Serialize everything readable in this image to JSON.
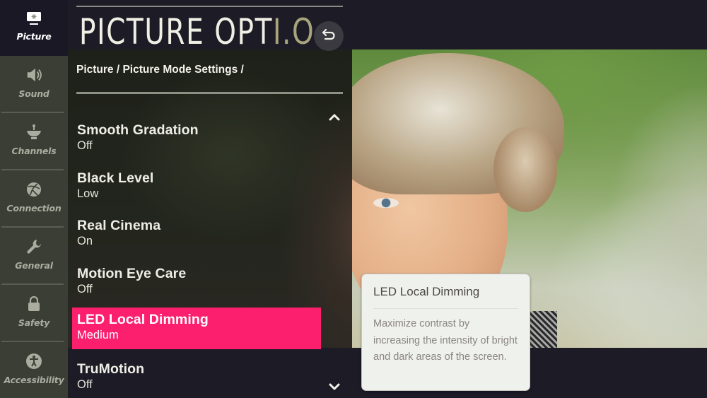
{
  "sidebar": {
    "items": [
      {
        "label": "Picture",
        "icon": "tv-picture-icon",
        "active": true
      },
      {
        "label": "Sound",
        "icon": "speaker-icon",
        "active": false
      },
      {
        "label": "Channels",
        "icon": "satellite-dish-icon",
        "active": false
      },
      {
        "label": "Connection",
        "icon": "globe-connection-icon",
        "active": false
      },
      {
        "label": "General",
        "icon": "wrench-icon",
        "active": false
      },
      {
        "label": "Safety",
        "icon": "lock-icon",
        "active": false
      },
      {
        "label": "Accessibility",
        "icon": "accessibility-person-icon",
        "active": false
      }
    ]
  },
  "header": {
    "title_main": "PICTURE OPT",
    "title_fading": "I.O",
    "back_icon": "back-arrow-icon",
    "breadcrumb": "Picture / Picture Mode Settings /"
  },
  "menu": {
    "scroll_up_icon": "chevron-up-icon",
    "scroll_down_icon": "chevron-down-icon",
    "items": [
      {
        "name": "Smooth Gradation",
        "value": "Off",
        "selected": false
      },
      {
        "name": "Black Level",
        "value": "Low",
        "selected": false
      },
      {
        "name": "Real Cinema",
        "value": "On",
        "selected": false
      },
      {
        "name": "Motion Eye Care",
        "value": "Off",
        "selected": false
      },
      {
        "name": "LED Local Dimming",
        "value": "Medium",
        "selected": true
      },
      {
        "name": "TruMotion",
        "value": "Off",
        "selected": false
      }
    ]
  },
  "tooltip": {
    "title": "LED Local Dimming",
    "body": "Maximize contrast by increasing the intensity of bright and dark areas of the screen."
  },
  "colors": {
    "accent": "#fb1f6e",
    "sidebar_bg": "#3b3e34",
    "sidebar_active_bg": "#1a1824",
    "screen_bg": "#1c1b26",
    "tooltip_bg": "#eff1ec"
  }
}
